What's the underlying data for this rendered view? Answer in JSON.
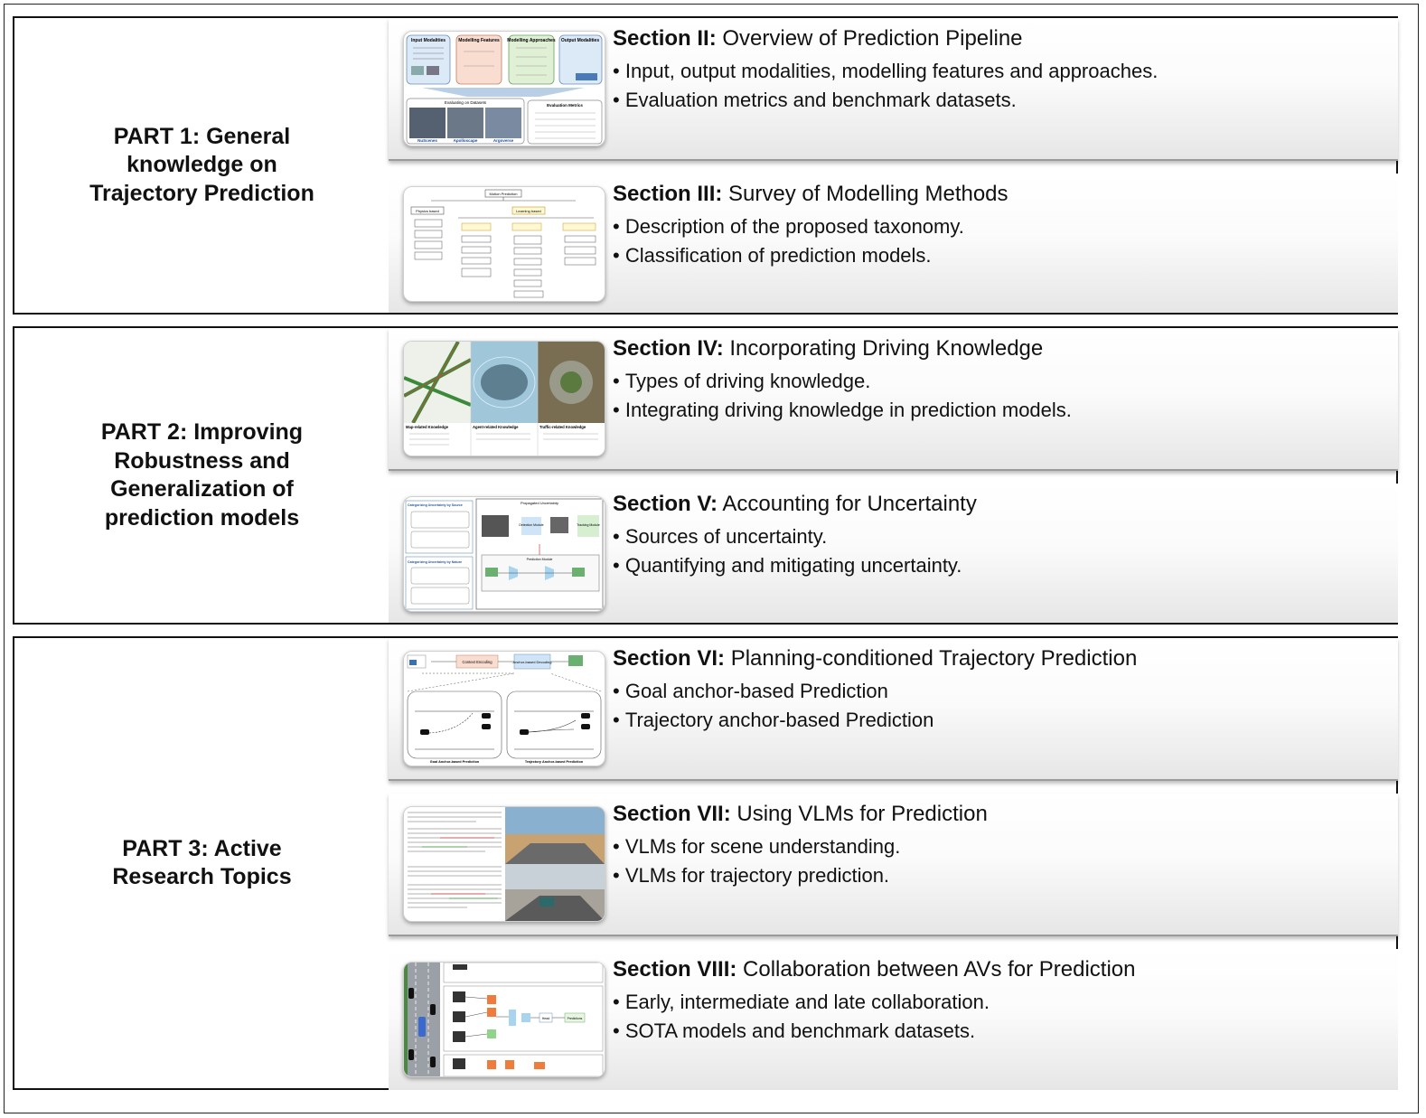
{
  "parts": [
    {
      "label": "PART 1:  General\nknowledge on\nTrajectory Prediction",
      "sections": [
        {
          "number": "Section II:",
          "title": "Overview of Prediction Pipeline",
          "bullets": [
            "Input, output modalities, modelling features and approaches.",
            "Evaluation metrics and benchmark datasets."
          ],
          "thumb": {
            "boxes": [
              "Input Modalities",
              "Modelling Features",
              "Modelling Approaches",
              "Output Modalities"
            ],
            "datasets_header": "Evaluating on Datasets",
            "datasets": [
              "NuScenes",
              "Apolloscape",
              "Argoverse"
            ],
            "metrics_header": "Evaluation Metrics"
          }
        },
        {
          "number": "Section III:",
          "title": "Survey of Modelling Methods",
          "bullets": [
            "Description of the proposed taxonomy.",
            "Classification of prediction models."
          ],
          "thumb": {
            "root": "Motion Prediction",
            "left": "Physics based",
            "right": "Learning based"
          }
        }
      ]
    },
    {
      "label": "PART 2:  Improving\nRobustness and\nGeneralization of\nprediction models",
      "sections": [
        {
          "number": "Section IV:",
          "title": "Incorporating Driving Knowledge",
          "bullets": [
            "Types of driving knowledge.",
            "Integrating driving knowledge in prediction models."
          ],
          "thumb": {
            "captions": [
              "Map-related Knowledge",
              "Agent-related Knowledge",
              "Traffic-related Knowledge"
            ]
          }
        },
        {
          "number": "Section V:",
          "title": "Accounting for Uncertainty",
          "bullets": [
            "Sources of uncertainty.",
            "Quantifying and mitigating uncertainty."
          ],
          "thumb": {
            "left_header_1": "Categorizing Uncertainty by Source",
            "left_header_2": "Categorizing Uncertainty by Nature",
            "right_header": "Propagated Uncertainty",
            "module_1": "Detection Module",
            "module_2": "Tracking Module",
            "module_3": "Prediction Module"
          }
        }
      ]
    },
    {
      "label": "PART 3:  Active\nResearch Topics",
      "sections": [
        {
          "number": "Section VI:",
          "title": "Planning-conditioned Trajectory Prediction",
          "bullets": [
            "Goal anchor-based Prediction",
            "Trajectory anchor-based Prediction"
          ],
          "thumb": {
            "box_1": "Context Encoding",
            "box_2": "Anchor-based Decoding",
            "caption_1": "Goal Anchor-based Prediction",
            "caption_2": "Trajectory Anchor-based Prediction"
          }
        },
        {
          "number": "Section VII:",
          "title": "Using VLMs for Prediction",
          "bullets": [
            "VLMs for scene understanding.",
            "VLMs for trajectory prediction."
          ],
          "thumb": {}
        },
        {
          "number": "Section VIII:",
          "title": "Collaboration between AVs for Prediction",
          "bullets": [
            "Early, intermediate and late collaboration.",
            "SOTA models and benchmark datasets."
          ],
          "thumb": {
            "head": "Head",
            "output": "Predictions"
          }
        }
      ]
    }
  ],
  "colors": {
    "input_box": "#dce9f7",
    "feature_box": "#f9ddd0",
    "approach_box": "#dff0d5",
    "output_box": "#dce9f7",
    "orange_block": "#ef7c3a",
    "green_block": "#8fd48a",
    "blue_block": "#a9d4ef"
  }
}
